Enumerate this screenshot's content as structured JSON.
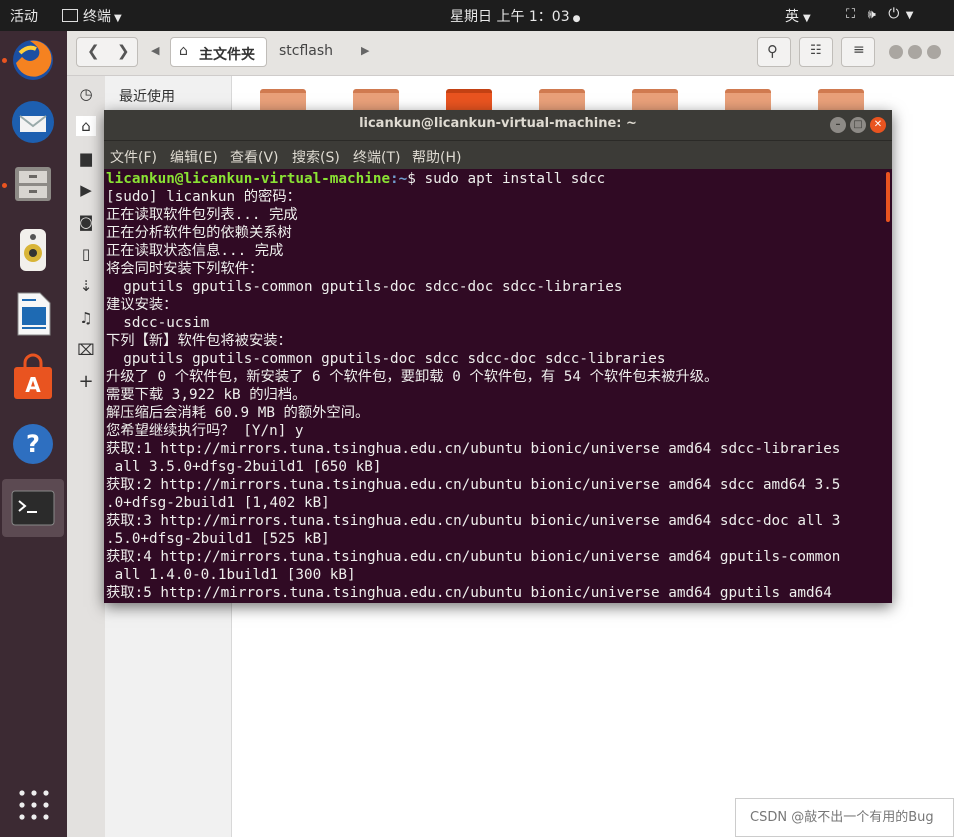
{
  "topbar": {
    "activities": "活动",
    "app_menu": "终端",
    "clock": "星期日 上午 1：03",
    "input_method": "英",
    "icons": [
      "terminal-icon",
      "chevron-down-icon",
      "network-icon",
      "volume-icon",
      "power-icon"
    ]
  },
  "dock": {
    "apps": [
      "firefox",
      "thunderbird",
      "files",
      "rhythmbox",
      "libreoffice-writer",
      "ubuntu-software",
      "help",
      "terminal"
    ],
    "show_apps_icon": "grid-icon"
  },
  "files": {
    "path": [
      "主文件夹",
      "stcflash"
    ],
    "sidebar_recent": "最近使用"
  },
  "terminal": {
    "title": "licankun@licankun-virtual-machine: ~",
    "menu": [
      "文件(F)",
      "编辑(E)",
      "查看(V)",
      "搜索(S)",
      "终端(T)",
      "帮助(H)"
    ],
    "prompt_user": "licankun@licankun-virtual-machine",
    "prompt_path": ":~",
    "prompt_cmd": "$ sudo apt install sdcc",
    "lines": [
      "[sudo] licankun 的密码：",
      "正在读取软件包列表... 完成",
      "正在分析软件包的依赖关系树",
      "正在读取状态信息... 完成",
      "将会同时安装下列软件：",
      "  gputils gputils-common gputils-doc sdcc-doc sdcc-libraries",
      "建议安装：",
      "  sdcc-ucsim",
      "下列【新】软件包将被安装：",
      "  gputils gputils-common gputils-doc sdcc sdcc-doc sdcc-libraries",
      "升级了 0 个软件包，新安装了 6 个软件包，要卸载 0 个软件包，有 54 个软件包未被升级。",
      "需要下载 3,922 kB 的归档。",
      "解压缩后会消耗 60.9 MB 的额外空间。",
      "您希望继续执行吗？ [Y/n] y",
      "获取:1 http://mirrors.tuna.tsinghua.edu.cn/ubuntu bionic/universe amd64 sdcc-libraries",
      " all 3.5.0+dfsg-2build1 [650 kB]",
      "获取:2 http://mirrors.tuna.tsinghua.edu.cn/ubuntu bionic/universe amd64 sdcc amd64 3.5",
      ".0+dfsg-2build1 [1,402 kB]",
      "获取:3 http://mirrors.tuna.tsinghua.edu.cn/ubuntu bionic/universe amd64 sdcc-doc all 3",
      ".5.0+dfsg-2build1 [525 kB]",
      "获取:4 http://mirrors.tuna.tsinghua.edu.cn/ubuntu bionic/universe amd64 gputils-common",
      " all 1.4.0-0.1build1 [300 kB]",
      "获取:5 http://mirrors.tuna.tsinghua.edu.cn/ubuntu bionic/universe amd64 gputils amd64"
    ]
  },
  "watermark": "CSDN @敲不出一个有用的Bug"
}
